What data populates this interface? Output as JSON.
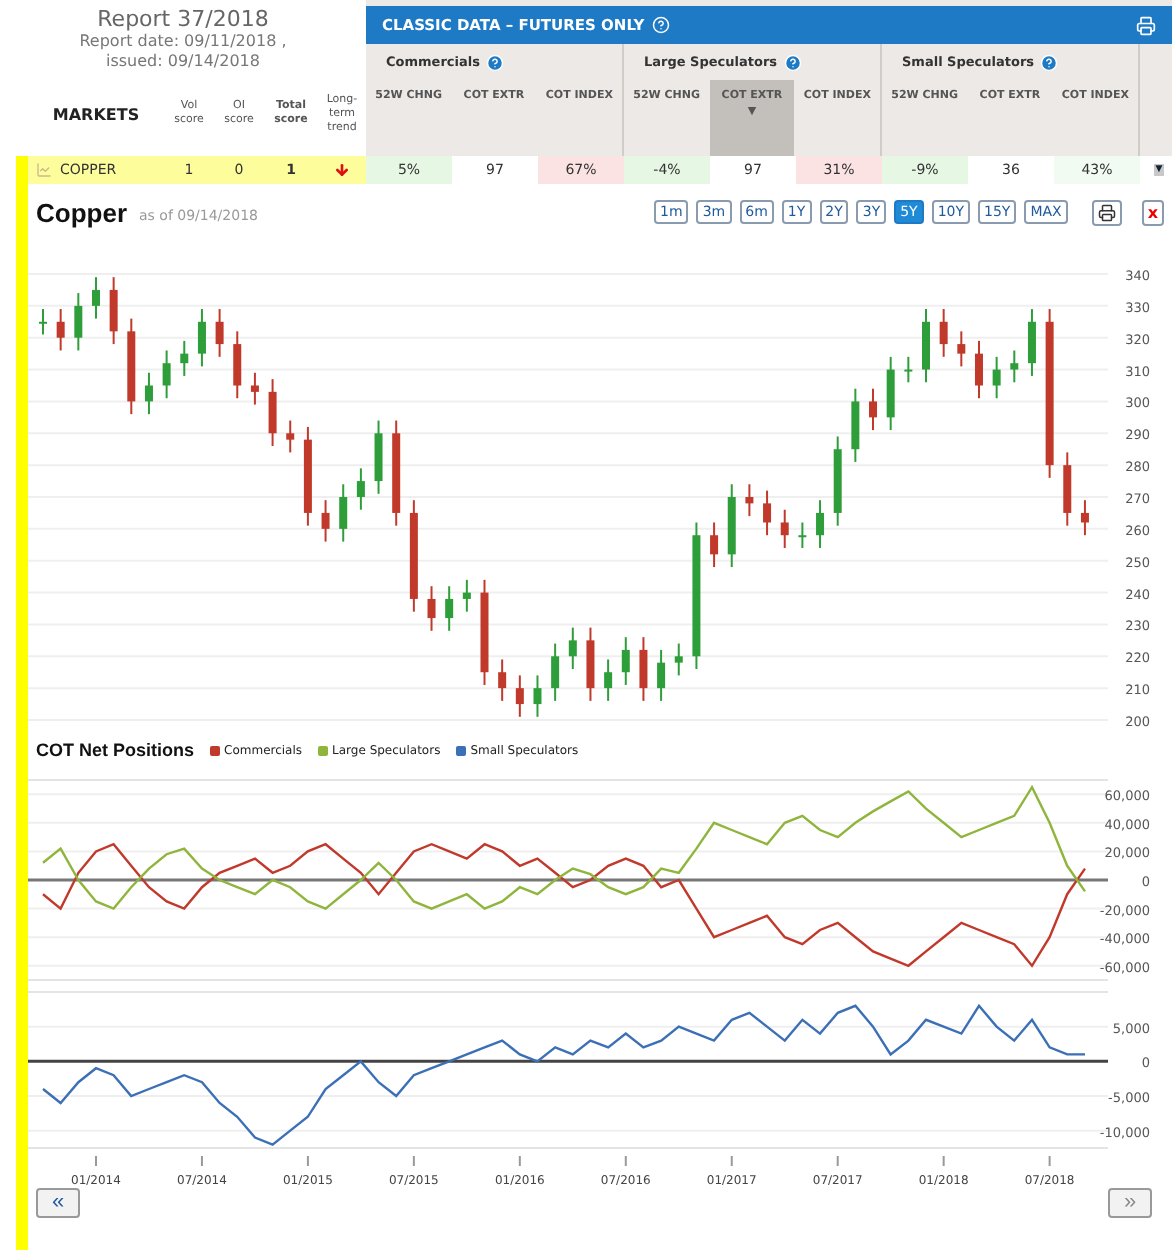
{
  "report": {
    "title": "Report 37/2018",
    "report_date": "Report date: 09/11/2018 ,",
    "issued": "issued: 09/14/2018"
  },
  "markets_header": {
    "label": "MARKETS",
    "columns": [
      "Vol score",
      "OI score",
      "Total score",
      "Long-term trend"
    ]
  },
  "classic_header": {
    "title": "CLASSIC DATA – FUTURES ONLY"
  },
  "groups": [
    {
      "name": "Commercials",
      "columns": [
        {
          "label": "52W CHNG",
          "sorted": false
        },
        {
          "label": "COT EXTR",
          "sorted": false
        },
        {
          "label": "COT INDEX",
          "sorted": false
        }
      ]
    },
    {
      "name": "Large Speculators",
      "columns": [
        {
          "label": "52W CHNG",
          "sorted": false
        },
        {
          "label": "COT EXTR",
          "sorted": true,
          "caret": "▼"
        },
        {
          "label": "COT INDEX",
          "sorted": false
        }
      ]
    },
    {
      "name": "Small Speculators",
      "columns": [
        {
          "label": "52W CHNG",
          "sorted": false
        },
        {
          "label": "COT EXTR",
          "sorted": false
        },
        {
          "label": "COT INDEX",
          "sorted": false
        }
      ]
    }
  ],
  "rows": [
    {
      "market": "COPPER",
      "vol": "1",
      "oi": "0",
      "total": "1",
      "falling": true,
      "dropdown": "▼",
      "cells": [
        {
          "value": "5%",
          "color": "#e6f8e4"
        },
        {
          "value": "97",
          "color": "#ffffff"
        },
        {
          "value": "67%",
          "color": "#fbe3e3"
        },
        {
          "value": "-4%",
          "color": "#e6f8e4"
        },
        {
          "value": "97",
          "color": "#ffffff"
        },
        {
          "value": "31%",
          "color": "#fbe3e3"
        },
        {
          "value": "-9%",
          "color": "#e6f8e4"
        },
        {
          "value": "36",
          "color": "#ffffff"
        },
        {
          "value": "43%",
          "color": "#f2fbf1"
        }
      ]
    }
  ],
  "price_chart": {
    "title": "Copper",
    "as_of": "as of 09/14/2018",
    "close": "x",
    "ranges": [
      {
        "label": "1m",
        "selected": false
      },
      {
        "label": "3m",
        "selected": false
      },
      {
        "label": "6m",
        "selected": false
      },
      {
        "label": "1Y",
        "selected": false
      },
      {
        "label": "2Y",
        "selected": false
      },
      {
        "label": "3Y",
        "selected": false
      },
      {
        "label": "5Y",
        "selected": true
      },
      {
        "label": "10Y",
        "selected": false
      },
      {
        "label": "15Y",
        "selected": false
      },
      {
        "label": "MAX",
        "selected": false
      }
    ],
    "chart_data": {
      "type": "candlestick",
      "grid": true,
      "ohlc": [
        [
          325,
          329,
          321,
          325
        ],
        [
          325,
          329,
          316,
          320
        ],
        [
          320,
          334,
          316,
          330
        ],
        [
          330,
          339,
          326,
          335
        ],
        [
          335,
          339,
          318,
          322
        ],
        [
          322,
          326,
          296,
          300
        ],
        [
          300,
          309,
          296,
          305
        ],
        [
          305,
          316,
          301,
          312
        ],
        [
          312,
          319,
          308,
          315
        ],
        [
          315,
          329,
          311,
          325
        ],
        [
          325,
          329,
          314,
          318
        ],
        [
          318,
          322,
          301,
          305
        ],
        [
          305,
          309,
          299,
          303
        ],
        [
          303,
          307,
          286,
          290
        ],
        [
          290,
          294,
          284,
          288
        ],
        [
          288,
          292,
          261,
          265
        ],
        [
          265,
          269,
          256,
          260
        ],
        [
          260,
          274,
          256,
          270
        ],
        [
          270,
          279,
          266,
          275
        ],
        [
          275,
          294,
          271,
          290
        ],
        [
          290,
          294,
          261,
          265
        ],
        [
          265,
          269,
          234,
          238
        ],
        [
          238,
          242,
          228,
          232
        ],
        [
          232,
          242,
          228,
          238
        ],
        [
          238,
          244,
          234,
          240
        ],
        [
          240,
          244,
          211,
          215
        ],
        [
          215,
          219,
          206,
          210
        ],
        [
          210,
          214,
          201,
          205
        ],
        [
          205,
          214,
          201,
          210
        ],
        [
          210,
          224,
          206,
          220
        ],
        [
          220,
          229,
          216,
          225
        ],
        [
          225,
          229,
          206,
          210
        ],
        [
          210,
          219,
          206,
          215
        ],
        [
          215,
          226,
          211,
          222
        ],
        [
          222,
          226,
          206,
          210
        ],
        [
          210,
          222,
          206,
          218
        ],
        [
          218,
          224,
          214,
          220
        ],
        [
          220,
          262,
          216,
          258
        ],
        [
          258,
          262,
          248,
          252
        ],
        [
          252,
          274,
          248,
          270
        ],
        [
          270,
          274,
          264,
          268
        ],
        [
          268,
          272,
          258,
          262
        ],
        [
          262,
          266,
          254,
          258
        ],
        [
          258,
          262,
          254,
          258
        ],
        [
          258,
          269,
          254,
          265
        ],
        [
          265,
          289,
          261,
          285
        ],
        [
          285,
          304,
          281,
          300
        ],
        [
          300,
          304,
          291,
          295
        ],
        [
          295,
          314,
          291,
          310
        ],
        [
          310,
          314,
          306,
          310
        ],
        [
          310,
          329,
          306,
          325
        ],
        [
          325,
          329,
          314,
          318
        ],
        [
          318,
          322,
          311,
          315
        ],
        [
          315,
          319,
          301,
          305
        ],
        [
          305,
          314,
          301,
          310
        ],
        [
          310,
          316,
          306,
          312
        ],
        [
          312,
          329,
          308,
          325
        ],
        [
          325,
          329,
          276,
          280
        ],
        [
          280,
          284,
          261,
          265
        ],
        [
          265,
          269,
          258,
          262
        ]
      ],
      "ylim": [
        200,
        340
      ],
      "yticks": [
        200,
        210,
        220,
        230,
        240,
        250,
        260,
        270,
        280,
        290,
        300,
        310,
        320,
        330,
        340
      ]
    }
  },
  "net_positions": {
    "title": "COT Net Positions",
    "nav_prev": "«",
    "nav_next": "»",
    "panes": [
      {
        "chart_data": {
          "type": "line",
          "grid": true,
          "series": [
            {
              "name": "Commercials",
              "color": "#c0392b",
              "values": [
                -10000,
                -20000,
                5000,
                20000,
                25000,
                10000,
                -5000,
                -15000,
                -20000,
                -5000,
                5000,
                10000,
                15000,
                5000,
                10000,
                20000,
                25000,
                15000,
                5000,
                -10000,
                5000,
                20000,
                25000,
                20000,
                15000,
                25000,
                20000,
                10000,
                15000,
                5000,
                -5000,
                0,
                10000,
                15000,
                10000,
                -5000,
                0,
                -20000,
                -40000,
                -35000,
                -30000,
                -25000,
                -40000,
                -45000,
                -35000,
                -30000,
                -40000,
                -50000,
                -55000,
                -60000,
                -50000,
                -40000,
                -30000,
                -35000,
                -40000,
                -45000,
                -60000,
                -40000,
                -10000,
                8000
              ]
            },
            {
              "name": "Large Speculators",
              "color": "#8fb53c",
              "values": [
                12000,
                22000,
                0,
                -15000,
                -20000,
                -5000,
                8000,
                18000,
                22000,
                8000,
                0,
                -5000,
                -10000,
                0,
                -5000,
                -15000,
                -20000,
                -10000,
                0,
                12000,
                0,
                -15000,
                -20000,
                -15000,
                -10000,
                -20000,
                -15000,
                -5000,
                -10000,
                0,
                8000,
                4000,
                -5000,
                -10000,
                -5000,
                8000,
                5000,
                22000,
                40000,
                35000,
                30000,
                25000,
                40000,
                45000,
                35000,
                30000,
                40000,
                48000,
                55000,
                62000,
                50000,
                40000,
                30000,
                35000,
                40000,
                45000,
                65000,
                40000,
                10000,
                -8000
              ]
            }
          ],
          "ylim": [
            -70000,
            70000
          ],
          "yticks": [
            {
              "value": 60000,
              "label": "60,000"
            },
            {
              "value": 40000,
              "label": "40,000"
            },
            {
              "value": 20000,
              "label": "20,000"
            },
            {
              "value": 0,
              "label": "0"
            },
            {
              "value": -20000,
              "label": "-20,000"
            },
            {
              "value": -40000,
              "label": "-40,000"
            },
            {
              "value": -60000,
              "label": "-60,000"
            }
          ]
        }
      },
      {
        "chart_data": {
          "type": "line",
          "grid": true,
          "categories": [
            null,
            null,
            null,
            "01/2014",
            null,
            null,
            null,
            null,
            null,
            "07/2014",
            null,
            null,
            null,
            null,
            null,
            "01/2015",
            null,
            null,
            null,
            null,
            null,
            "07/2015",
            null,
            null,
            null,
            null,
            null,
            "01/2016",
            null,
            null,
            null,
            null,
            null,
            "07/2016",
            null,
            null,
            null,
            null,
            null,
            "01/2017",
            null,
            null,
            null,
            null,
            null,
            "07/2017",
            null,
            null,
            null,
            null,
            null,
            "01/2018",
            null,
            null,
            null,
            null,
            null,
            "07/2018",
            null,
            null
          ],
          "series": [
            {
              "name": "Small Speculators",
              "color": "#3b6fb6",
              "values": [
                -4000,
                -6000,
                -3000,
                -1000,
                -2000,
                -5000,
                -4000,
                -3000,
                -2000,
                -3000,
                -6000,
                -8000,
                -11000,
                -12000,
                -10000,
                -8000,
                -4000,
                -2000,
                0,
                -3000,
                -5000,
                -2000,
                -1000,
                0,
                1000,
                2000,
                3000,
                1000,
                0,
                2000,
                1000,
                3000,
                2000,
                4000,
                2000,
                3000,
                5000,
                4000,
                3000,
                6000,
                7000,
                5000,
                3000,
                6000,
                4000,
                7000,
                8000,
                5000,
                1000,
                3000,
                6000,
                5000,
                4000,
                8000,
                5000,
                3000,
                6000,
                2000,
                1000,
                1000
              ]
            }
          ],
          "ylim": [
            -12500,
            10000
          ],
          "yticks": [
            {
              "value": 5000,
              "label": "5,000"
            },
            {
              "value": 0,
              "label": "0"
            },
            {
              "value": -5000,
              "label": "-5,000"
            },
            {
              "value": -10000,
              "label": "-10,000"
            }
          ]
        }
      }
    ]
  }
}
